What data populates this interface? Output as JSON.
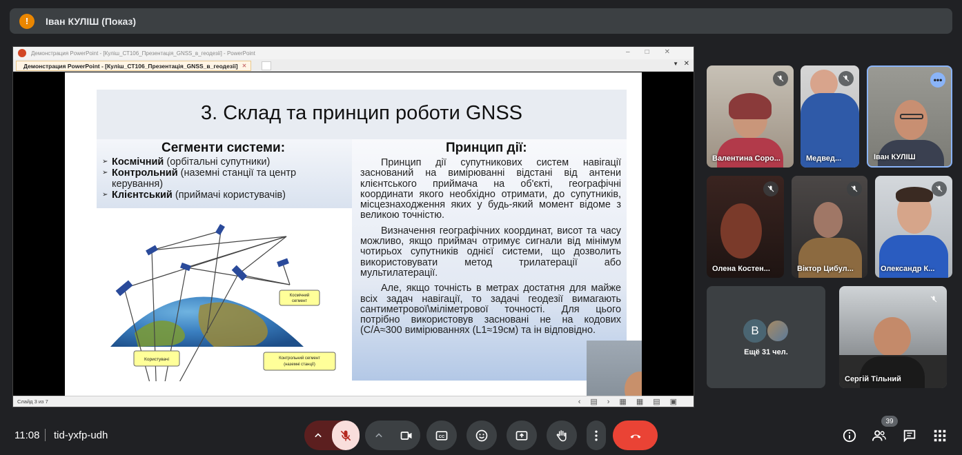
{
  "banner": {
    "title": "Іван КУЛІШ (Показ)",
    "icon": "warning-icon",
    "icon_glyph": "!"
  },
  "presentation": {
    "window_title": "Демонстрация PowerPoint - [Куліш_СТ106_Презентація_GNSS_в_геодезії] - PowerPoint",
    "tab_label": "Демонстрация PowerPoint - [Куліш_СТ106_Презентація_GNSS_в_геодезії]",
    "status": "Слайд 3 из 7",
    "slide": {
      "title": "3. Склад та принцип роботи GNSS",
      "left_heading": "Сегменти системи:",
      "bullets": [
        {
          "bold": "Космічний",
          "rest": " (орбітальні супутники)"
        },
        {
          "bold": "Контрольний",
          "rest": " (наземні станції та центр керування)"
        },
        {
          "bold": "Клієнтський",
          "rest": " (приймачі користувачів)"
        }
      ],
      "right_heading": "Принцип дії:",
      "paragraphs": [
        "Принцип дії супутникових систем навігації заснований на вимірюванні відстані від антени клієнтського приймача на об'єкті, географічні координати якого необхідно отримати, до супутників, місцезнаходження яких у будь-який момент відоме з великою точністю.",
        "Визначення географічних координат, висот та часу можливо, якщо приймач отримує сигнали від мінімум чотирьох супутників однієї системи, що дозволить використовувати метод трилатерації або мультилатерації.",
        "Але, якщо точність в метрах достатня для майже всіх задач навігації, то задачі геодезії вимагають сантиметрової\\міліметрової точності. Для цього потрібно використовув засновані не на кодових (C/A≈300 вимірюваннях (L1≈19см) та ін відповідно."
      ],
      "diagram_labels": {
        "space": "Космічний сегмент",
        "control": "Контрольний сегмент (наземні станції)",
        "users": "Користувачі"
      }
    }
  },
  "participants": [
    {
      "name": "Валентина Соро...",
      "muted": true
    },
    {
      "name": "Медвед...",
      "muted": true
    },
    {
      "name": "Іван КУЛІШ",
      "muted": false,
      "menu": "•••"
    },
    {
      "name": "Олена Костен...",
      "muted": true
    },
    {
      "name": "Віктор Цибул...",
      "muted": true
    },
    {
      "name": "Олександр К...",
      "muted": true
    },
    {
      "name": "Сергій Тільний",
      "muted": true
    }
  ],
  "others": {
    "label": "Ещё 31 чел.",
    "initial": "B"
  },
  "meeting": {
    "time": "11:08",
    "code": "tid-yxfp-udh",
    "participant_count": "39"
  },
  "controls": [
    "expand-audio-icon",
    "mic-off-icon",
    "expand-video-icon",
    "camera-icon",
    "captions-icon",
    "emoji-icon",
    "present-icon",
    "raise-hand-icon",
    "more-options-icon",
    "end-call-icon"
  ],
  "colors": {
    "background": "#202124",
    "end_call": "#ea4335",
    "mic_off": "#f9dedc",
    "accent": "#8ab4f8"
  }
}
